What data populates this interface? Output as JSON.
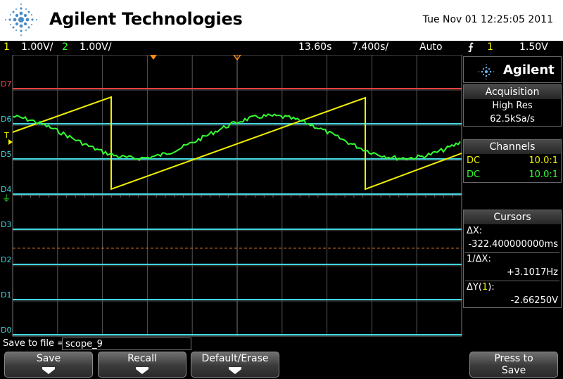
{
  "header": {
    "brand": "Agilent Technologies",
    "datetime": "Tue Nov 01 12:25:05 2011"
  },
  "status": {
    "ch1_num": "1",
    "ch1_scale": "1.00V/",
    "ch2_num": "2",
    "ch2_scale": "1.00V/",
    "time_delay": "13.60s",
    "time_base": "7.400s/",
    "trigger_mode": "Auto",
    "trigger_source": "1",
    "trigger_level": "1.50V"
  },
  "digital_labels": [
    "D7",
    "D6",
    "D5",
    "D4",
    "D3",
    "D2",
    "D1",
    "D0"
  ],
  "ground_marker": "T",
  "panel": {
    "logo": "Agilent",
    "acquisition": {
      "title": "Acquisition",
      "mode": "High Res",
      "rate": "62.5kSa/s"
    },
    "channels": {
      "title": "Channels",
      "rows": [
        {
          "coupling": "DC",
          "probe": "10.0:1",
          "color": "#f0f000"
        },
        {
          "coupling": "DC",
          "probe": "10.0:1",
          "color": "#33ff33"
        }
      ]
    },
    "cursors": {
      "title": "Cursors",
      "dx_label": "ΔX:",
      "dx_value": "-322.400000000ms",
      "inv_dx_label": "1/ΔX:",
      "inv_dx_value": "+3.1017Hz",
      "dy_label_prefix": "ΔY(",
      "dy_label_channel": "1",
      "dy_label_suffix": "):",
      "dy_value": "-2.66250V"
    }
  },
  "save": {
    "label": "Save to file =",
    "filename": "scope_9"
  },
  "softkeys": [
    {
      "label": "Save",
      "has_arrow": true
    },
    {
      "label": "Recall",
      "has_arrow": true
    },
    {
      "label": "Default/Erase",
      "has_arrow": true
    },
    {
      "label": "Press to Save",
      "has_arrow": false
    }
  ],
  "colors": {
    "ch1": "#f0f000",
    "ch2": "#33ff33",
    "digital": "#40d8e0",
    "d7": "#ff4040",
    "grid": "#666666",
    "cursor": "#d07020",
    "trigger_marker": "#ff8c1a"
  }
}
